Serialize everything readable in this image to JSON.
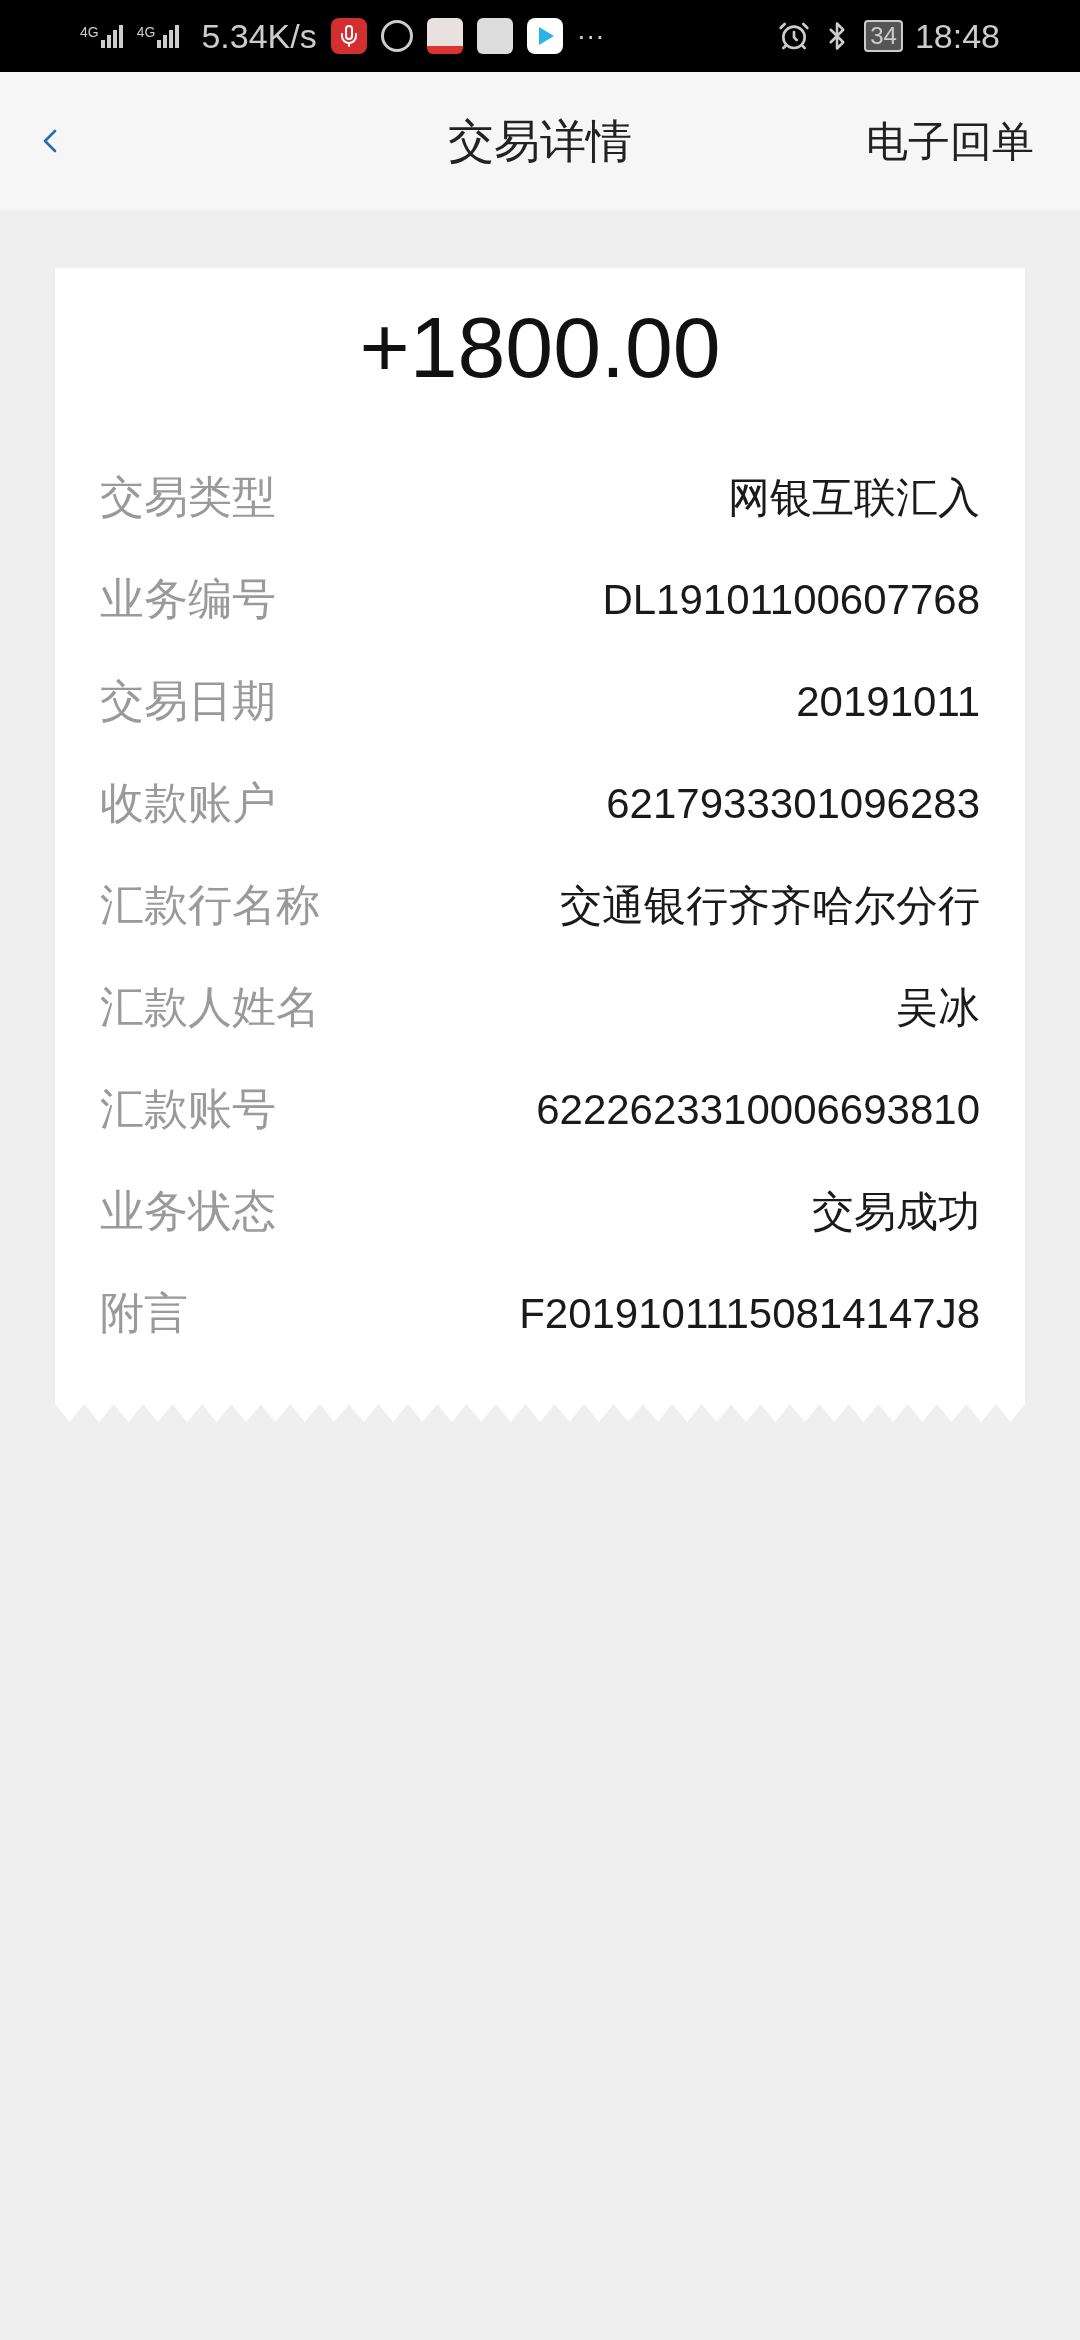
{
  "status_bar": {
    "signal_labels": [
      "4G",
      "4G"
    ],
    "speed": "5.34K/s",
    "more": "···",
    "battery": "34",
    "time": "18:48"
  },
  "header": {
    "title": "交易详情",
    "action": "电子回单"
  },
  "amount": "+1800.00",
  "details": [
    {
      "label": "交易类型",
      "value": "网银互联汇入"
    },
    {
      "label": "业务编号",
      "value": "DL19101100607768"
    },
    {
      "label": "交易日期",
      "value": "20191011"
    },
    {
      "label": "收款账户",
      "value": "6217933301096283"
    },
    {
      "label": "汇款行名称",
      "value": "交通银行齐齐哈尔分行"
    },
    {
      "label": "汇款人姓名",
      "value": "吴冰"
    },
    {
      "label": "汇款账号",
      "value": "6222623310006693810"
    },
    {
      "label": "业务状态",
      "value": "交易成功"
    },
    {
      "label": "附言",
      "value": "F20191011150814147J8"
    }
  ]
}
